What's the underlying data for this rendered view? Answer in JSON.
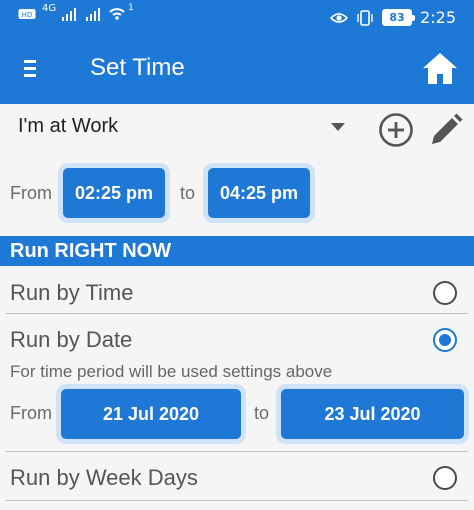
{
  "status_bar": {
    "left_icons": [
      "sim-hd-icon",
      "signal-4g-icon",
      "signal-icon",
      "wifi-icon"
    ],
    "network_label": "4G",
    "notification_count": "1",
    "battery": "83",
    "time": "2:25"
  },
  "app_bar": {
    "title": "Set Time"
  },
  "profile": {
    "selected": "I'm at Work"
  },
  "time_range": {
    "from_label": "From",
    "from_time": "02:25 pm",
    "to_label": "to",
    "to_time": "04:25 pm"
  },
  "run_now": {
    "label": "Run RIGHT NOW"
  },
  "options": {
    "by_time": "Run by Time",
    "by_date": "Run by Date",
    "by_week_days": "Run by Week Days",
    "selected": "by_date"
  },
  "date_range": {
    "hint": "For time period will be used settings above",
    "from_label": "From",
    "from_date": "21 Jul 2020",
    "to_label": "to",
    "to_date": "23 Jul 2020"
  },
  "colors": {
    "primary": "#1e78d6",
    "time_box_border": "#cfe2f7",
    "text_muted": "#6b6b6b"
  }
}
